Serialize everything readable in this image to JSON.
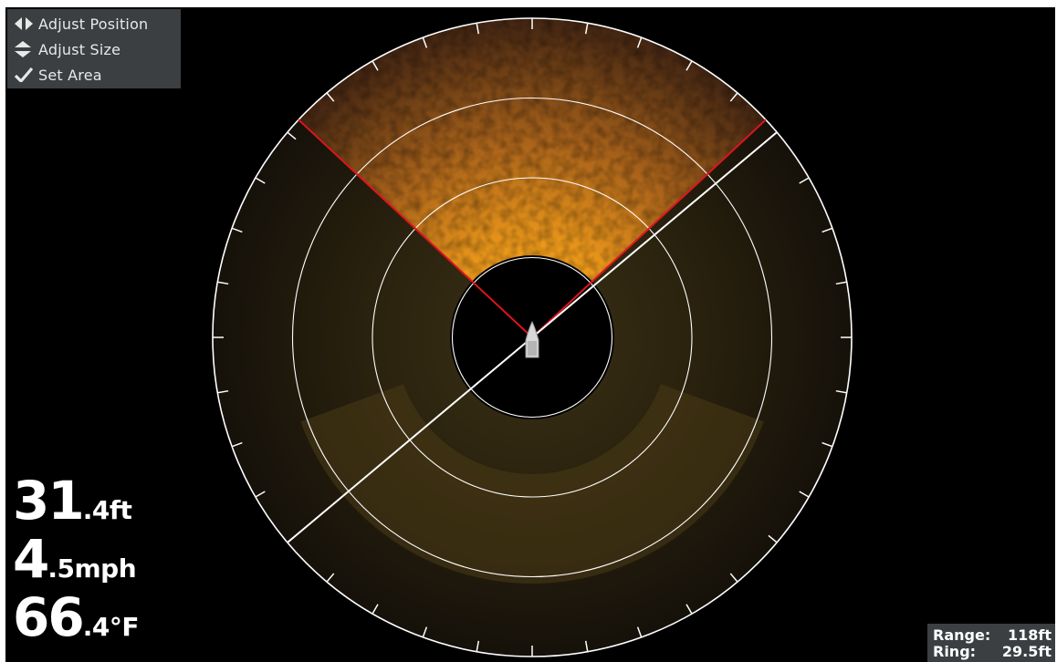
{
  "controls": {
    "items": [
      {
        "label": "Adjust Position",
        "icon": "left-right-arrows-icon"
      },
      {
        "label": "Adjust Size",
        "icon": "up-down-arrows-icon"
      },
      {
        "label": "Set Area",
        "icon": "checkmark-icon"
      }
    ]
  },
  "readouts": {
    "depth": {
      "whole": "31",
      "fraction": ".4ft"
    },
    "speed": {
      "whole": "4",
      "fraction": ".5mph"
    },
    "temperature": {
      "whole": "66",
      "fraction": ".4°F"
    }
  },
  "range_box": {
    "range_label": "Range:",
    "range_value": "118ft",
    "ring_label": "Ring:",
    "ring_value": "29.5ft"
  },
  "sonar": {
    "range_ft": 118,
    "ring_spacing_ft": 29.5,
    "selected_sector_deg": [
      -47,
      47
    ],
    "heading_line_deg": 230,
    "colors": {
      "returns": "#e39a1e",
      "selection_edge": "#e0141e",
      "rings": "#ffffff",
      "background": "#000000"
    }
  }
}
